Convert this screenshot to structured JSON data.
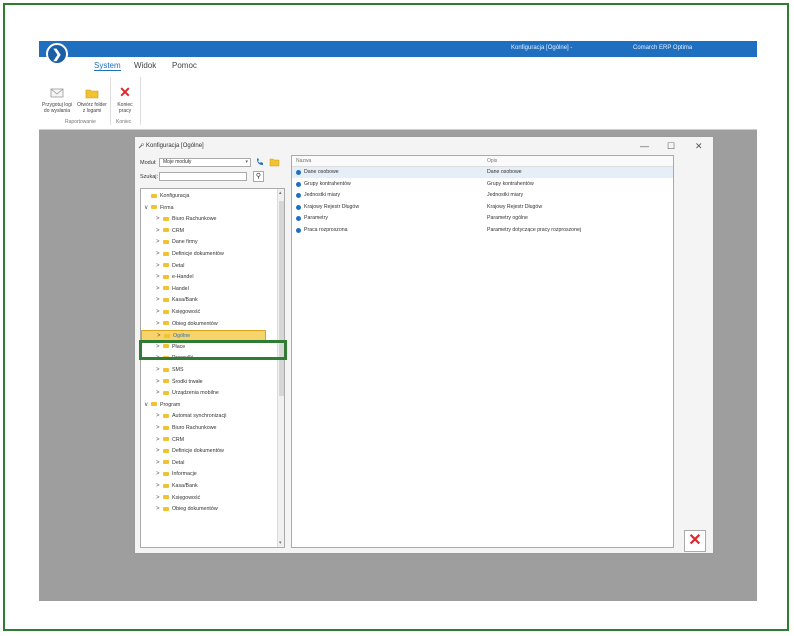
{
  "window": {
    "title": "Konfiguracja [Ogólne] -",
    "app_name": "Comarch ERP Optima"
  },
  "menu": {
    "items": [
      "System",
      "Widok",
      "Pomoc"
    ],
    "active": "System"
  },
  "ribbon": {
    "btn_logs": "Przygotuj logi do wysłania",
    "btn_folder": "Otwórz folder z logami",
    "btn_exit": "Koniec pracy",
    "group_reporting": "Raportowanie",
    "group_exit": "Koniec"
  },
  "dialog": {
    "title": "Konfiguracja [Ogólne]",
    "module_label": "Moduł:",
    "module_value": "Moje moduły",
    "search_label": "Szukaj:",
    "search_value": "",
    "controls": {
      "minimize": "—",
      "maximize": "☐",
      "close": "✕"
    }
  },
  "tree": [
    {
      "label": "Konfiguracja",
      "level": 0,
      "chev": ""
    },
    {
      "label": "Firma",
      "level": 0,
      "chev": "∨"
    },
    {
      "label": "Biuro Rachunkowe",
      "level": 1,
      "chev": ">"
    },
    {
      "label": "CRM",
      "level": 1,
      "chev": ">"
    },
    {
      "label": "Dane firmy",
      "level": 1,
      "chev": ">"
    },
    {
      "label": "Definicje dokumentów",
      "level": 1,
      "chev": ">"
    },
    {
      "label": "Detal",
      "level": 1,
      "chev": ">"
    },
    {
      "label": "e-Handel",
      "level": 1,
      "chev": ">"
    },
    {
      "label": "Handel",
      "level": 1,
      "chev": ">"
    },
    {
      "label": "Kasa/Bank",
      "level": 1,
      "chev": ">"
    },
    {
      "label": "Księgowość",
      "level": 1,
      "chev": ">"
    },
    {
      "label": "Obieg dokumentów",
      "level": 1,
      "chev": ">"
    },
    {
      "label": "Ogólne",
      "level": 1,
      "chev": ">",
      "selected": true
    },
    {
      "label": "Płace",
      "level": 1,
      "chev": ">"
    },
    {
      "label": "Przesyłki",
      "level": 1,
      "chev": ">"
    },
    {
      "label": "SMS",
      "level": 1,
      "chev": ">"
    },
    {
      "label": "Środki trwałe",
      "level": 1,
      "chev": ">"
    },
    {
      "label": "Urządzenia mobilne",
      "level": 1,
      "chev": ">"
    },
    {
      "label": "Program",
      "level": 0,
      "chev": "∨"
    },
    {
      "label": "Automat synchronizacji",
      "level": 1,
      "chev": ">"
    },
    {
      "label": "Biuro Rachunkowe",
      "level": 1,
      "chev": ">"
    },
    {
      "label": "CRM",
      "level": 1,
      "chev": ">"
    },
    {
      "label": "Definicje dokumentów",
      "level": 1,
      "chev": ">"
    },
    {
      "label": "Detal",
      "level": 1,
      "chev": ">"
    },
    {
      "label": "Informacje",
      "level": 1,
      "chev": ">"
    },
    {
      "label": "Kasa/Bank",
      "level": 1,
      "chev": ">"
    },
    {
      "label": "Księgowość",
      "level": 1,
      "chev": ">"
    },
    {
      "label": "Obieg dokumentów",
      "level": 1,
      "chev": ">"
    }
  ],
  "grid": {
    "col_name": "Nazwa",
    "col_desc": "Opis",
    "rows": [
      {
        "name": "Dane osobowe",
        "desc": "Dane osobowe"
      },
      {
        "name": "Grupy kontrahentów",
        "desc": "Grupy kontrahentów"
      },
      {
        "name": "Jednostki miary",
        "desc": "Jednostki miary"
      },
      {
        "name": "Krajowy Rejestr Długów",
        "desc": "Krajowy Rejestr Długów"
      },
      {
        "name": "Parametry",
        "desc": "Parametry ogólne"
      },
      {
        "name": "Praca rozproszona",
        "desc": "Parametry dotyczące pracy rozproszonej"
      }
    ]
  },
  "colors": {
    "accent": "#1f6fc1",
    "highlight_box": "#2e7d32",
    "selected_node": "#f7d46b",
    "close_x": "#e0262b"
  },
  "close_icon_glyph": "✕"
}
